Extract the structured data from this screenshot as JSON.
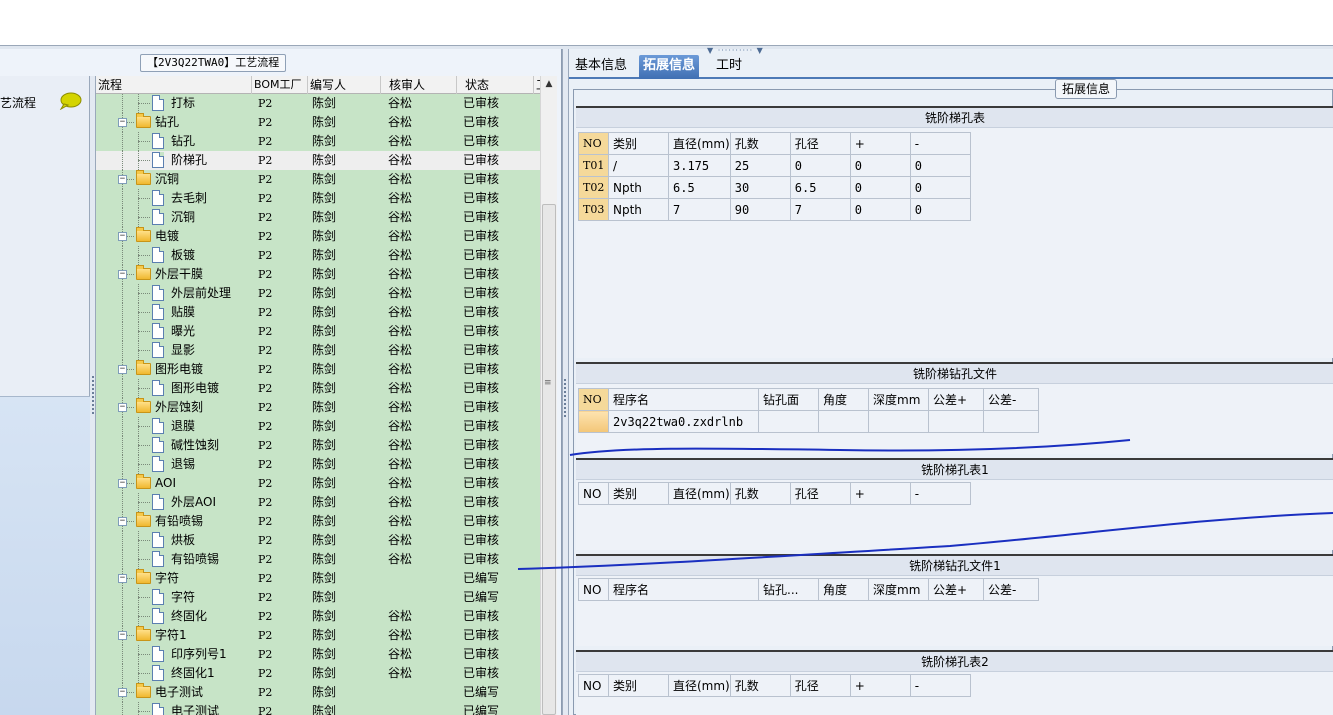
{
  "left_panel": {
    "caption": "【2V3Q22TWA0】工艺流程",
    "nav_item_label": "艺流程"
  },
  "grid": {
    "columns": [
      "流程",
      "BOM工厂",
      "编写人",
      "核审人",
      "状态",
      "工"
    ],
    "rows": [
      {
        "name": "打标",
        "type": "doc",
        "level": 2,
        "bom": "P2",
        "writer": "陈剑",
        "reviewer": "谷松",
        "status": "已审核"
      },
      {
        "name": "钻孔",
        "type": "folder",
        "level": 1,
        "bom": "P2",
        "writer": "陈剑",
        "reviewer": "谷松",
        "status": "已审核"
      },
      {
        "name": "钻孔",
        "type": "doc",
        "level": 2,
        "bom": "P2",
        "writer": "陈剑",
        "reviewer": "谷松",
        "status": "已审核"
      },
      {
        "name": "阶梯孔",
        "type": "doc",
        "level": 2,
        "bom": "P2",
        "writer": "陈剑",
        "reviewer": "谷松",
        "status": "已审核",
        "selected": true
      },
      {
        "name": "沉铜",
        "type": "folder",
        "level": 1,
        "bom": "P2",
        "writer": "陈剑",
        "reviewer": "谷松",
        "status": "已审核"
      },
      {
        "name": "去毛刺",
        "type": "doc",
        "level": 2,
        "bom": "P2",
        "writer": "陈剑",
        "reviewer": "谷松",
        "status": "已审核"
      },
      {
        "name": "沉铜",
        "type": "doc",
        "level": 2,
        "bom": "P2",
        "writer": "陈剑",
        "reviewer": "谷松",
        "status": "已审核"
      },
      {
        "name": "电镀",
        "type": "folder",
        "level": 1,
        "bom": "P2",
        "writer": "陈剑",
        "reviewer": "谷松",
        "status": "已审核"
      },
      {
        "name": "板镀",
        "type": "doc",
        "level": 2,
        "bom": "P2",
        "writer": "陈剑",
        "reviewer": "谷松",
        "status": "已审核"
      },
      {
        "name": "外层干膜",
        "type": "folder",
        "level": 1,
        "bom": "P2",
        "writer": "陈剑",
        "reviewer": "谷松",
        "status": "已审核"
      },
      {
        "name": "外层前处理",
        "type": "doc",
        "level": 2,
        "bom": "P2",
        "writer": "陈剑",
        "reviewer": "谷松",
        "status": "已审核"
      },
      {
        "name": "贴膜",
        "type": "doc",
        "level": 2,
        "bom": "P2",
        "writer": "陈剑",
        "reviewer": "谷松",
        "status": "已审核"
      },
      {
        "name": "曝光",
        "type": "doc",
        "level": 2,
        "bom": "P2",
        "writer": "陈剑",
        "reviewer": "谷松",
        "status": "已审核"
      },
      {
        "name": "显影",
        "type": "doc",
        "level": 2,
        "bom": "P2",
        "writer": "陈剑",
        "reviewer": "谷松",
        "status": "已审核"
      },
      {
        "name": "图形电镀",
        "type": "folder",
        "level": 1,
        "bom": "P2",
        "writer": "陈剑",
        "reviewer": "谷松",
        "status": "已审核"
      },
      {
        "name": "图形电镀",
        "type": "doc",
        "level": 2,
        "bom": "P2",
        "writer": "陈剑",
        "reviewer": "谷松",
        "status": "已审核"
      },
      {
        "name": "外层蚀刻",
        "type": "folder",
        "level": 1,
        "bom": "P2",
        "writer": "陈剑",
        "reviewer": "谷松",
        "status": "已审核"
      },
      {
        "name": "退膜",
        "type": "doc",
        "level": 2,
        "bom": "P2",
        "writer": "陈剑",
        "reviewer": "谷松",
        "status": "已审核"
      },
      {
        "name": "碱性蚀刻",
        "type": "doc",
        "level": 2,
        "bom": "P2",
        "writer": "陈剑",
        "reviewer": "谷松",
        "status": "已审核"
      },
      {
        "name": "退锡",
        "type": "doc",
        "level": 2,
        "bom": "P2",
        "writer": "陈剑",
        "reviewer": "谷松",
        "status": "已审核"
      },
      {
        "name": "AOI",
        "type": "folder",
        "level": 1,
        "bom": "P2",
        "writer": "陈剑",
        "reviewer": "谷松",
        "status": "已审核"
      },
      {
        "name": "外层AOI",
        "type": "doc",
        "level": 2,
        "bom": "P2",
        "writer": "陈剑",
        "reviewer": "谷松",
        "status": "已审核"
      },
      {
        "name": "有铅喷锡",
        "type": "folder",
        "level": 1,
        "bom": "P2",
        "writer": "陈剑",
        "reviewer": "谷松",
        "status": "已审核"
      },
      {
        "name": "烘板",
        "type": "doc",
        "level": 2,
        "bom": "P2",
        "writer": "陈剑",
        "reviewer": "谷松",
        "status": "已审核"
      },
      {
        "name": "有铅喷锡",
        "type": "doc",
        "level": 2,
        "bom": "P2",
        "writer": "陈剑",
        "reviewer": "谷松",
        "status": "已审核"
      },
      {
        "name": "字符",
        "type": "folder",
        "level": 1,
        "bom": "P2",
        "writer": "陈剑",
        "reviewer": "",
        "status": "已编写"
      },
      {
        "name": "字符",
        "type": "doc",
        "level": 2,
        "bom": "P2",
        "writer": "陈剑",
        "reviewer": "",
        "status": "已编写"
      },
      {
        "name": "终固化",
        "type": "doc",
        "level": 2,
        "bom": "P2",
        "writer": "陈剑",
        "reviewer": "谷松",
        "status": "已审核"
      },
      {
        "name": "字符1",
        "type": "folder",
        "level": 1,
        "bom": "P2",
        "writer": "陈剑",
        "reviewer": "谷松",
        "status": "已审核"
      },
      {
        "name": "印序列号1",
        "type": "doc",
        "level": 2,
        "bom": "P2",
        "writer": "陈剑",
        "reviewer": "谷松",
        "status": "已审核"
      },
      {
        "name": "终固化1",
        "type": "doc",
        "level": 2,
        "bom": "P2",
        "writer": "陈剑",
        "reviewer": "谷松",
        "status": "已审核"
      },
      {
        "name": "电子测试",
        "type": "folder",
        "level": 1,
        "bom": "P2",
        "writer": "陈剑",
        "reviewer": "",
        "status": "已编写"
      },
      {
        "name": "电子测试",
        "type": "doc",
        "level": 2,
        "bom": "P2",
        "writer": "陈剑",
        "reviewer": "",
        "status": "已编写"
      }
    ]
  },
  "right_panel": {
    "tabs": [
      {
        "label": "基本信息",
        "active": false
      },
      {
        "label": "拓展信息",
        "active": true
      },
      {
        "label": "工时",
        "active": false
      }
    ],
    "group_caption": "拓展信息",
    "sections": [
      {
        "title": "铣阶梯孔表",
        "headers": [
          "NO",
          "类别",
          "直径(mm)",
          "孔数",
          "孔径",
          "+",
          "-"
        ],
        "rows": [
          [
            "T01",
            "/",
            "3.175",
            "25",
            "0",
            "0",
            "0"
          ],
          [
            "T02",
            "Npth",
            "6.5",
            "30",
            "6.5",
            "0",
            "0"
          ],
          [
            "T03",
            "Npth",
            "7",
            "90",
            "7",
            "0",
            "0"
          ]
        ]
      },
      {
        "title": "铣阶梯钻孔文件",
        "headers": [
          "NO",
          "程序名",
          "钻孔面",
          "角度",
          "深度mm",
          "公差+",
          "公差-"
        ],
        "rows": [
          [
            "",
            "2v3q22twa0.zxdrlnb",
            "",
            "",
            "",
            "",
            ""
          ]
        ]
      },
      {
        "title": "铣阶梯孔表1",
        "headers": [
          "NO",
          "类别",
          "直径(mm)",
          "孔数",
          "孔径",
          "+",
          "-"
        ],
        "rows": []
      },
      {
        "title": "铣阶梯钻孔文件1",
        "headers": [
          "NO",
          "程序名",
          "钻孔...",
          "角度",
          "深度mm",
          "公差+",
          "公差-"
        ],
        "rows": []
      },
      {
        "title": "铣阶梯孔表2",
        "headers": [
          "NO",
          "类别",
          "直径(mm)",
          "孔数",
          "孔径",
          "+",
          "-"
        ],
        "rows": []
      }
    ]
  },
  "colors": {
    "grid_background": "#c7e4c7",
    "active_tab": "#3f6fb3",
    "row_index_cell": "#f5d99a",
    "ink_stroke": "#1a2fc0"
  }
}
